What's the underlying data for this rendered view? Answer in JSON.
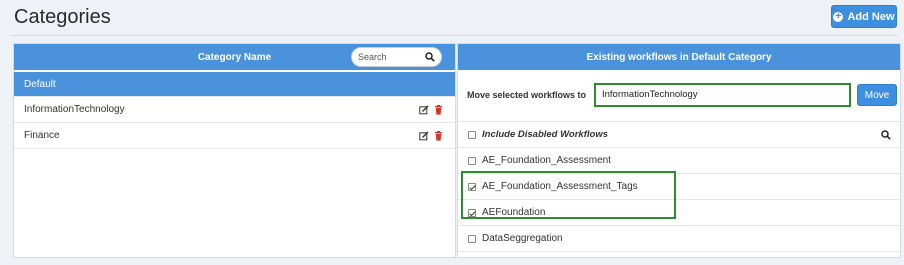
{
  "header": {
    "title": "Categories",
    "add_button_label": "Add New"
  },
  "left_panel": {
    "column_header": "Category Name",
    "search": {
      "placeholder": "Search",
      "value": ""
    },
    "categories": [
      {
        "name": "Default",
        "selected": true
      },
      {
        "name": "InformationTechnology",
        "selected": false
      },
      {
        "name": "Finance",
        "selected": false
      }
    ]
  },
  "right_panel": {
    "header": "Existing workflows in Default Category",
    "move": {
      "label": "Move selected workflows to",
      "target_value": "InformationTechnology",
      "button_label": "Move"
    },
    "include_disabled_label": "Include Disabled Workflows",
    "workflows": [
      {
        "name": "AE_Foundation_Assessment",
        "checked": false
      },
      {
        "name": "AE_Foundation_Assessment_Tags",
        "checked": true
      },
      {
        "name": "AEFoundation",
        "checked": true
      },
      {
        "name": "DataSeggregation",
        "checked": false
      }
    ]
  },
  "colors": {
    "accent": "#4a93dc",
    "button": "#3d8fe0",
    "highlight": "#2e8b2e",
    "delete": "#d9312b"
  }
}
